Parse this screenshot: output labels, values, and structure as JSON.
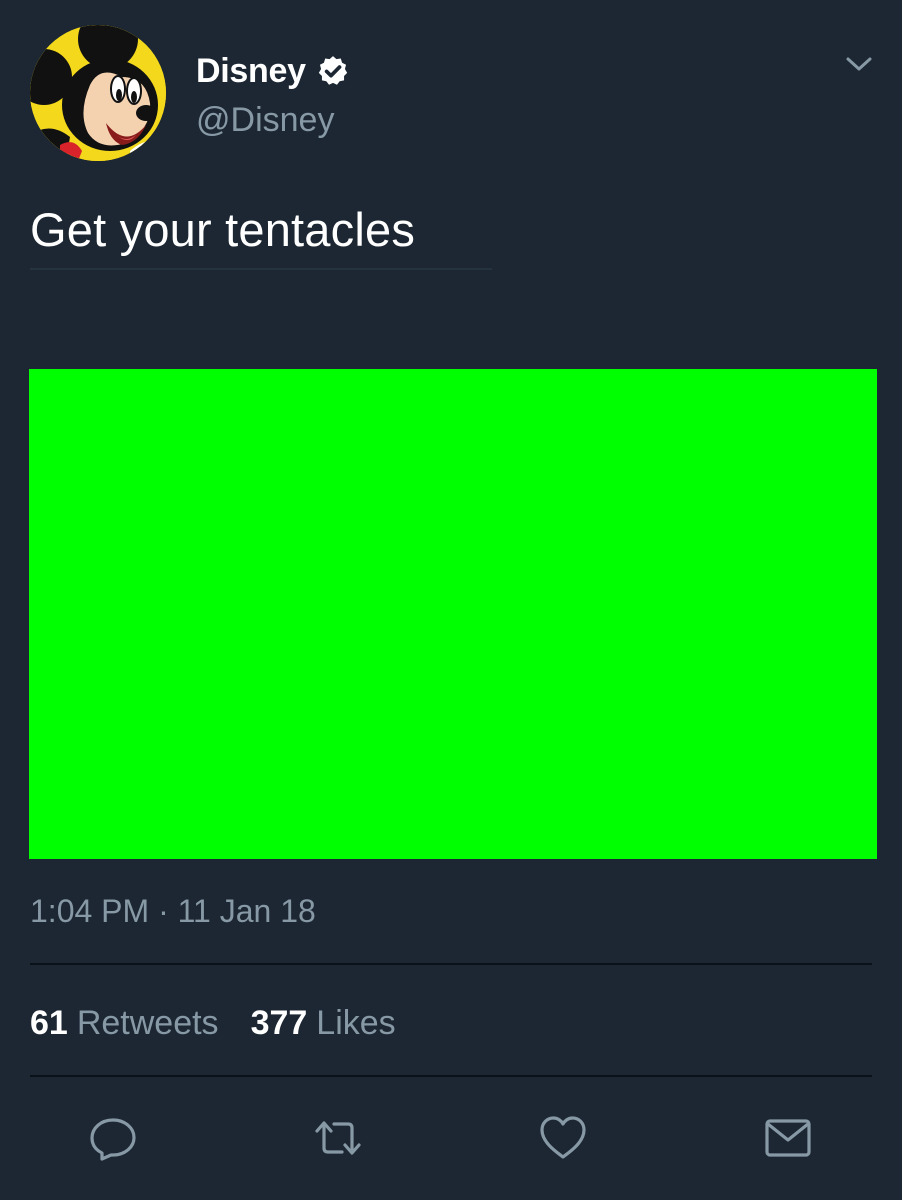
{
  "user": {
    "display_name": "Disney",
    "handle": "@Disney",
    "verified": true,
    "avatar_icon": "mickey-mouse-avatar"
  },
  "tweet": {
    "text": "Get your tentacles",
    "media_color": "#00ff00",
    "timestamp": "1:04 PM · 11 Jan 18"
  },
  "stats": {
    "retweets_count": "61",
    "retweets_label": "Retweets",
    "likes_count": "377",
    "likes_label": "Likes"
  },
  "actions": [
    {
      "icon": "reply-icon"
    },
    {
      "icon": "retweet-icon"
    },
    {
      "icon": "like-heart-icon"
    },
    {
      "icon": "direct-message-icon"
    }
  ],
  "colors": {
    "background": "#1c2733",
    "secondary_text": "#8899a6",
    "primary_text": "#ffffff"
  }
}
